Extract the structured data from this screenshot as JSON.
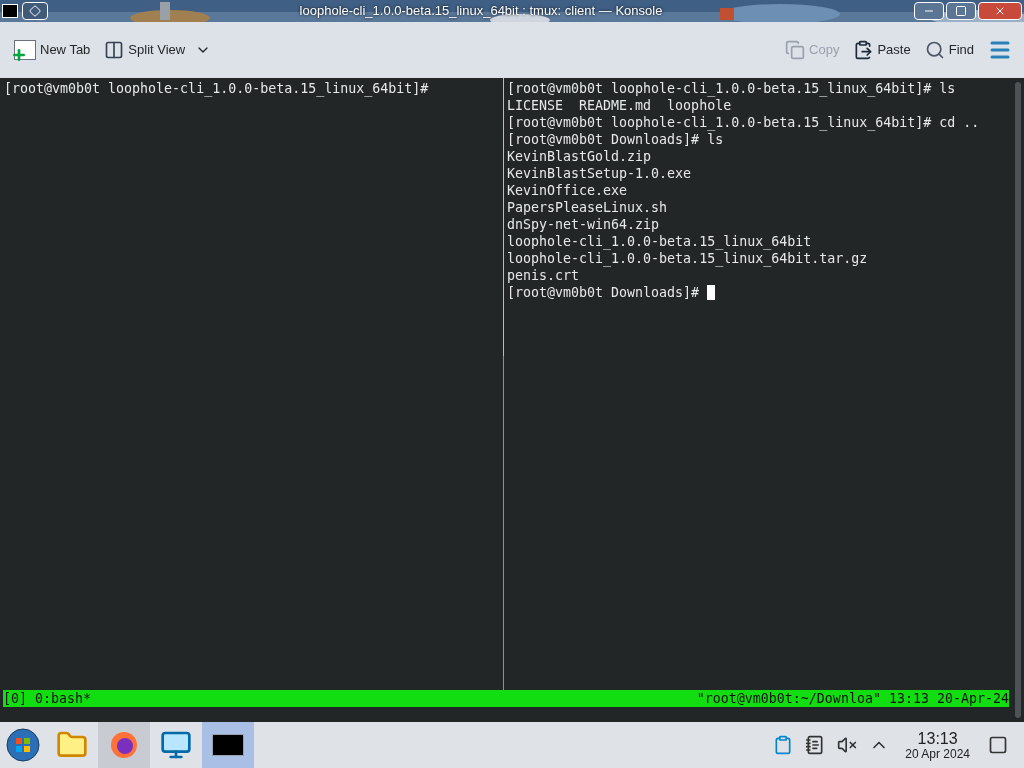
{
  "window": {
    "title": "loophole-cli_1.0.0-beta.15_linux_64bit : tmux: client — Konsole"
  },
  "toolbar": {
    "left": [
      {
        "label": "New Tab",
        "kind": "newtab",
        "disabled": false
      },
      {
        "label": "Split View",
        "kind": "split",
        "disabled": false
      }
    ],
    "right": [
      {
        "label": "Copy",
        "kind": "copy",
        "disabled": true
      },
      {
        "label": "Paste",
        "kind": "paste",
        "disabled": false
      },
      {
        "label": "Find",
        "kind": "find",
        "disabled": false
      }
    ]
  },
  "panes": [
    {
      "selected": false,
      "lines": [
        "[root@vm0b0t loophole-cli_1.0.0-beta.15_linux_64bit]#"
      ]
    },
    {
      "selected": true,
      "lines": [
        "[root@vm0b0t loophole-cli_1.0.0-beta.15_linux_64bit]# ls",
        "LICENSE  README.md  loophole",
        "[root@vm0b0t loophole-cli_1.0.0-beta.15_linux_64bit]# cd ..",
        "[root@vm0b0t Downloads]# ls",
        "KevinBlastGold.zip",
        "KevinBlastSetup-1.0.exe",
        "KevinOffice.exe",
        "PapersPleaseLinux.sh",
        "dnSpy-net-win64.zip",
        "loophole-cli_1.0.0-beta.15_linux_64bit",
        "loophole-cli_1.0.0-beta.15_linux_64bit.tar.gz",
        "penis.crt",
        "[root@vm0b0t Downloads]#"
      ]
    }
  ],
  "tmux_status": {
    "left": "[0] 0:bash*",
    "right": "\"root@vm0b0t:~/Downloa\" 13:13 20-Apr-24"
  },
  "taskbar": {
    "items": [
      {
        "kind": "files",
        "selected": false
      },
      {
        "kind": "browser",
        "selected": true
      },
      {
        "kind": "monitor",
        "selected": false
      },
      {
        "kind": "terminal",
        "selected": true
      }
    ],
    "clock": {
      "time": "13:13",
      "date": "20 Apr 2024"
    }
  }
}
